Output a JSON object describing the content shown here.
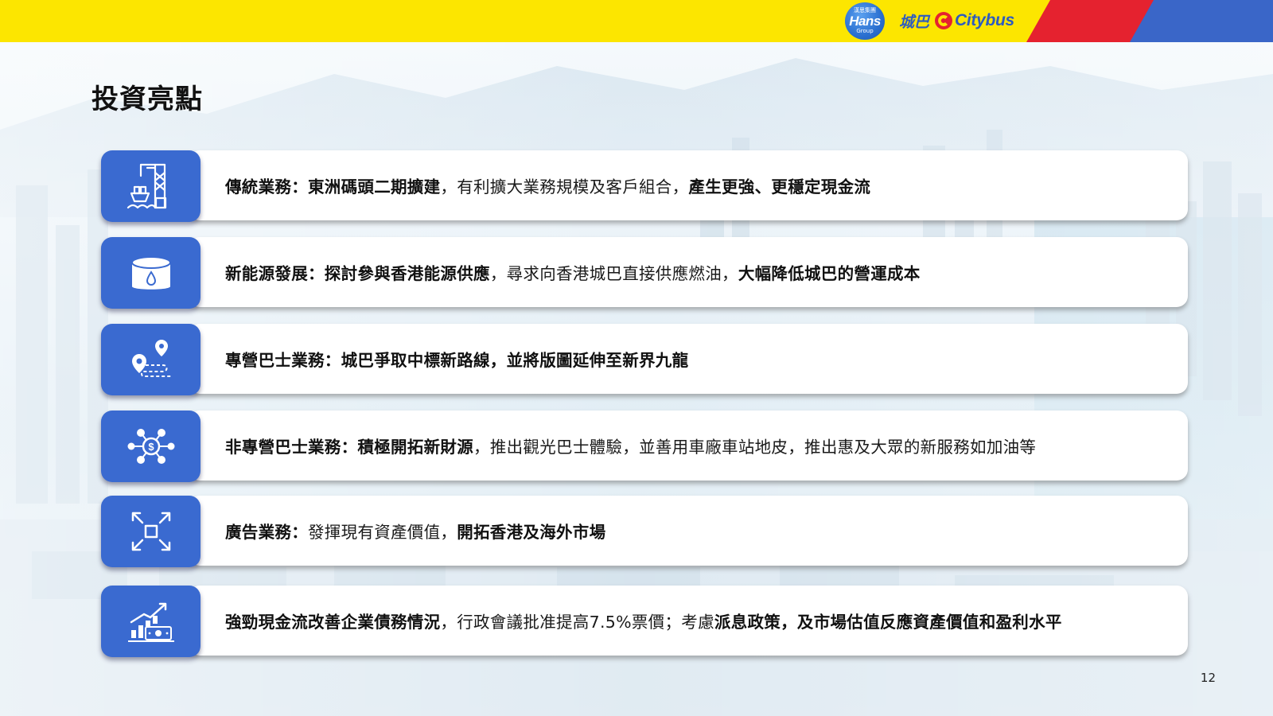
{
  "header": {
    "hans_logo": {
      "top": "漢思集團",
      "word": "Hans",
      "group": "Group"
    },
    "citybus_zh": "城巴",
    "citybus_en": "Citybus",
    "colors": {
      "yellow": "#fce600",
      "red": "#e5222f",
      "blue": "#3a66c8"
    }
  },
  "title": "投資亮點",
  "rows": [
    {
      "icon": "port-crane-ship-icon",
      "segments": [
        {
          "text": "傳統業務：東洲碼頭二期擴建",
          "bold": true
        },
        {
          "text": "，有利擴大業務規模及客戶組合，",
          "bold": false
        },
        {
          "text": "產生更強、更穩定現金流",
          "bold": true
        }
      ]
    },
    {
      "icon": "fuel-tank-drop-icon",
      "segments": [
        {
          "text": "新能源發展：探討參與香港能源供應",
          "bold": true
        },
        {
          "text": "，尋求向香港城巴直接供應燃油，",
          "bold": false
        },
        {
          "text": "大幅降低城巴的營運成本",
          "bold": true
        }
      ]
    },
    {
      "icon": "route-map-pin-icon",
      "segments": [
        {
          "text": "專營巴士業務：城巴爭取中標新路線，並將版圖延伸至新界九龍",
          "bold": true
        }
      ]
    },
    {
      "icon": "money-network-icon",
      "segments": [
        {
          "text": "非專營巴士業務：",
          "bold": true
        },
        {
          "text": "積極開拓新財源",
          "bold": true
        },
        {
          "text": "，推出觀光巴士體驗，並善用車廠車站地皮，推出惠及大眾的新服務如加油等",
          "bold": false
        }
      ]
    },
    {
      "icon": "expand-arrows-icon",
      "segments": [
        {
          "text": "廣告業務：",
          "bold": true
        },
        {
          "text": "發揮現有資產價值，",
          "bold": false
        },
        {
          "text": "開拓香港及海外市場",
          "bold": true
        }
      ]
    },
    {
      "icon": "growth-chart-cash-icon",
      "segments": [
        {
          "text": "強勁現金流改善企業債務情況",
          "bold": true
        },
        {
          "text": "，行政會議批准提高7.5%票價；考慮",
          "bold": false
        },
        {
          "text": "派息政策，及市場估值反應資產價值和盈利水平",
          "bold": true
        }
      ]
    }
  ],
  "page_number": "12"
}
